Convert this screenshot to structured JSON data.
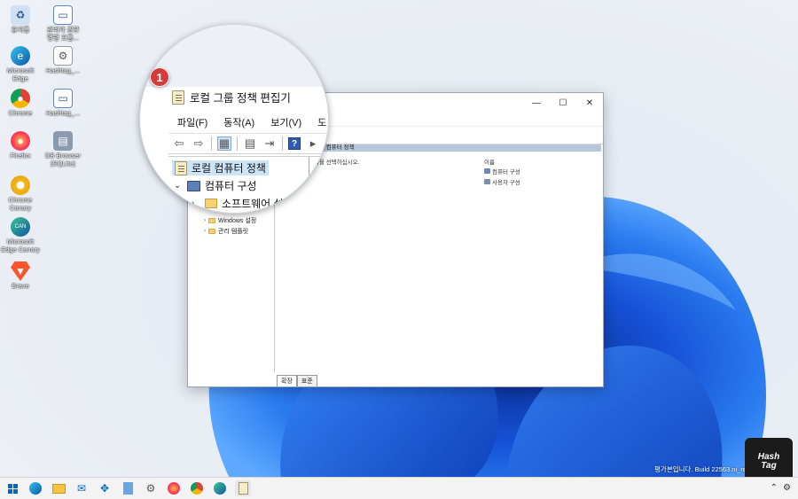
{
  "desktop_icons": [
    {
      "label": "휴지통",
      "icon": "recycle-bin-icon"
    },
    {
      "label": "관리자 권한\n명령 프롬...",
      "icon": "shortcut-icon"
    },
    {
      "label": "Microsoft\nEdge",
      "icon": "edge-icon"
    },
    {
      "label": "Hashtag_...",
      "icon": "file-icon"
    },
    {
      "label": "Chrome",
      "icon": "chrome-icon"
    },
    {
      "label": "Hashtag_...",
      "icon": "file-icon"
    },
    {
      "label": "Firefox",
      "icon": "firefox-icon"
    },
    {
      "label": "DB Browser\n(SQLite)",
      "icon": "db-icon"
    },
    {
      "label": "Chrome\nCanary",
      "icon": "chrome-canary-icon"
    },
    {
      "label": "Microsoft\nEdge Canary",
      "icon": "edge-canary-icon"
    },
    {
      "label": "Brave",
      "icon": "brave-icon"
    }
  ],
  "window": {
    "title": "로컬 그룹 정책 편집기",
    "menu": [
      "파일(F)",
      "동작(A)",
      "보기(V)",
      "도"
    ],
    "tree": {
      "root": "로컬 컴퓨터 정책",
      "computer": "컴퓨터 구성",
      "software": "소프트웨어 설",
      "windows_settings": "Windows 설정",
      "admin_templates": "관리 템플릿"
    },
    "right_header": "로컬 컴퓨터 정책",
    "prompt": "항목을 선택하십시오.",
    "column": "이름",
    "items": [
      "컴퓨터 구성",
      "사용자 구성"
    ],
    "tabs": [
      "확장",
      "표준"
    ]
  },
  "callout": "1",
  "build_text": "평가본입니다. Build 22563.ni_relea",
  "hashtag_badge": [
    "Hash",
    "Tag"
  ],
  "colors": {
    "accent": "#0067c0",
    "badge": "#d63b3b",
    "selection": "#cce4f7"
  }
}
